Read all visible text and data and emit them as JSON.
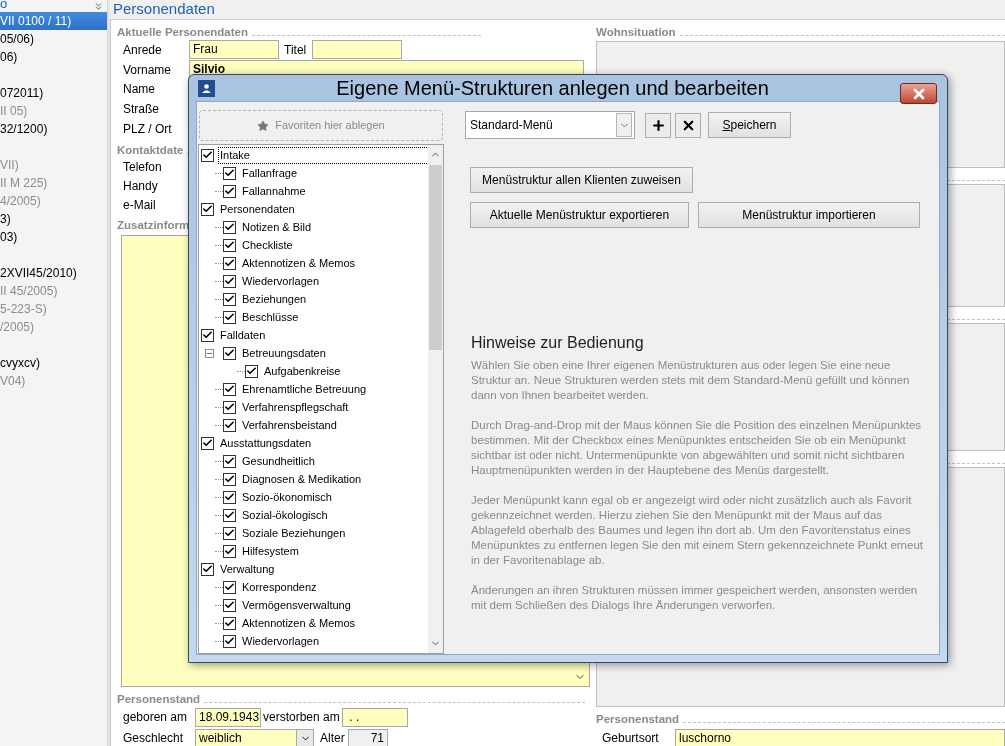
{
  "sidebar": {
    "header": "o",
    "groups": [
      {
        "items": [
          {
            "label": "VII 0100 / 11)",
            "selected": true,
            "inactive": false
          },
          {
            "label": "05/06)",
            "selected": false,
            "inactive": false
          },
          {
            "label": "06)",
            "selected": false,
            "inactive": false
          }
        ]
      },
      {
        "items": [
          {
            "label": "072011)",
            "selected": false,
            "inactive": false
          },
          {
            "label": "II 05)",
            "selected": false,
            "inactive": true
          },
          {
            "label": "32/1200)",
            "selected": false,
            "inactive": false
          }
        ]
      },
      {
        "items": [
          {
            "label": "VII)",
            "selected": false,
            "inactive": true
          },
          {
            "label": "II M 225)",
            "selected": false,
            "inactive": true
          },
          {
            "label": "4/2005)",
            "selected": false,
            "inactive": true
          },
          {
            "label": "3)",
            "selected": false,
            "inactive": false
          },
          {
            "label": "03)",
            "selected": false,
            "inactive": false
          }
        ]
      },
      {
        "items": [
          {
            "label": "2XVII45/2010)",
            "selected": false,
            "inactive": false
          },
          {
            "label": "II 45/2005)",
            "selected": false,
            "inactive": true
          },
          {
            "label": "5-223-S)",
            "selected": false,
            "inactive": true
          },
          {
            "label": "/2005)",
            "selected": false,
            "inactive": true
          }
        ]
      },
      {
        "items": [
          {
            "label": "cvyxcv)",
            "selected": false,
            "inactive": false
          },
          {
            "label": "V04)",
            "selected": false,
            "inactive": true
          }
        ]
      }
    ]
  },
  "form": {
    "title": "Personendaten",
    "person": {
      "heading": "Aktuelle Personendaten",
      "anrede": {
        "label": "Anrede",
        "value": "Frau"
      },
      "titel": {
        "label": "Titel"
      },
      "vorname": {
        "label": "Vorname",
        "value": "Silvio"
      },
      "labels": [
        "Name",
        "Straße",
        "PLZ / Ort"
      ]
    },
    "contact": {
      "heading": "Kontaktdate",
      "labels": [
        "Telefon",
        "Handy",
        "e-Mail"
      ]
    },
    "extra": {
      "heading": "Zusatzinform"
    },
    "civil": {
      "heading": "Personenstand",
      "born": {
        "label": "geboren am",
        "value": "18.09.1943"
      },
      "died": {
        "label": "verstorben am",
        "value": " . ."
      },
      "sex": {
        "label": "Geschlecht",
        "value": "weiblich"
      },
      "age": {
        "label": "Alter",
        "value": "71"
      }
    },
    "housing": {
      "heading": "Wohnsituation"
    },
    "civil_right": {
      "heading": "Personenstand",
      "birthplace": {
        "label": "Geburtsort",
        "value": "luschorno"
      }
    }
  },
  "dialog": {
    "title": "Eigene Menü-Strukturen anlegen und bearbeiten",
    "favorites": "Favoriten hier ablegen",
    "tree": [
      {
        "label": "Intake",
        "checked": true,
        "focused": true,
        "children": [
          {
            "label": "Fallanfrage",
            "checked": true
          },
          {
            "label": "Fallannahme",
            "checked": true
          }
        ]
      },
      {
        "label": "Personendaten",
        "checked": true,
        "children": [
          {
            "label": "Notizen & Bild",
            "checked": true
          },
          {
            "label": "Checkliste",
            "checked": true
          },
          {
            "label": "Aktennotizen & Memos",
            "checked": true
          },
          {
            "label": "Wiedervorlagen",
            "checked": true
          },
          {
            "label": "Beziehungen",
            "checked": true
          },
          {
            "label": "Beschlüsse",
            "checked": true
          }
        ]
      },
      {
        "label": "Falldaten",
        "checked": true,
        "children": [
          {
            "label": "Betreuungsdaten",
            "checked": true,
            "expanded": true,
            "children": [
              {
                "label": "Aufgabenkreise",
                "checked": true
              }
            ]
          },
          {
            "label": "Ehrenamtliche Betreuung",
            "checked": true
          },
          {
            "label": "Verfahrenspflegschaft",
            "checked": true
          },
          {
            "label": "Verfahrensbeistand",
            "checked": true
          }
        ]
      },
      {
        "label": "Ausstattungsdaten",
        "checked": true,
        "children": [
          {
            "label": "Gesundheitlich",
            "checked": true
          },
          {
            "label": "Diagnosen & Medikation",
            "checked": true
          },
          {
            "label": "Sozio-ökonomisch",
            "checked": true
          },
          {
            "label": "Sozial-ökologisch",
            "checked": true
          },
          {
            "label": "Soziale Beziehungen",
            "checked": true
          },
          {
            "label": "Hilfesystem",
            "checked": true
          }
        ]
      },
      {
        "label": "Verwaltung",
        "checked": true,
        "children": [
          {
            "label": "Korrespondenz",
            "checked": true
          },
          {
            "label": "Vermögensverwaltung",
            "checked": true
          },
          {
            "label": "Aktennotizen & Memos",
            "checked": true
          },
          {
            "label": "Wiedervorlagen",
            "checked": true
          }
        ]
      }
    ],
    "menu_select": "Standard-Menü",
    "save": {
      "accesskey": "S",
      "rest": "peichern"
    },
    "buttons": [
      "Menüstruktur allen Klienten zuweisen",
      "Aktuelle Menüstruktur exportieren",
      "Menüstruktur importieren"
    ],
    "help_heading": "Hinweise zur Bedienung",
    "help": [
      "Wählen Sie oben eine Ihrer eigenen Menüstrukturen aus oder legen Sie eine neue Struktur an. Neue Strukturen werden stets mit dem Standard-Menü gefüllt und können dann von Ihnen bearbeitet werden.",
      "Durch Drag-and-Drop mit der Maus können Sie die Position des einzelnen Menüpunktes bestimmen. Mit der Checkbox eines Menüpunktes entscheiden Sie ob ein Menüpunkt sichtbar ist oder nicht. Untermenüpunkte von abgewählten und somit nicht sichtbaren Hauptmenüpunkten werden in der Hauptebene des Menüs dargestellt.",
      "Jeder Menüpunkt kann egal ob er angezeigt wird oder nicht zusätzlich auch als Favorit gekennzeichnet werden. Hierzu ziehen Sie den Menüpunkt mit der Maus auf das Ablagefeld oberhalb des Baumes und legen ihn dort ab. Um den Favoritenstatus eines Menüpunktes zu entfernen legen Sie den mit einem Stern gekennzeichnete Punkt erneut in der Favoritenablage ab.",
      "Änderungen an ihren Strukturen müssen immer gespeichert werden, ansonsten werden mit dem Schließen des Dialogs Ihre Änderungen verworfen."
    ]
  }
}
